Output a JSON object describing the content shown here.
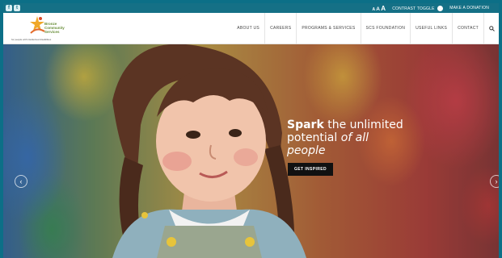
{
  "topbar": {
    "social": [
      {
        "icon": "facebook-icon",
        "glyph": "f"
      },
      {
        "icon": "twitter-icon",
        "glyph": "t"
      }
    ],
    "font_sizes": [
      "A",
      "A",
      "A"
    ],
    "contrast_label": "CONTRAST",
    "toggle_label": "TOGGLE",
    "donate_label": "MAKE A DONATION"
  },
  "logo": {
    "name_line1": "Bronze",
    "name_line2": "Community",
    "name_line3": "Services",
    "tagline": "for people with intellectual disabilities"
  },
  "nav": {
    "items": [
      "ABOUT US",
      "CAREERS",
      "PROGRAMS & SERVICES",
      "SCS FOUNDATION",
      "USEFUL LINKS",
      "CONTACT"
    ],
    "search_icon": "search-icon"
  },
  "hero": {
    "headline_bold": "Spark",
    "headline_rest1": " the unlimited",
    "headline_line2a": "potential ",
    "headline_line2b": "of all",
    "headline_line3": "people",
    "cta_label": "GET INSPIRED",
    "prev_icon": "chevron-left-icon",
    "next_icon": "chevron-right-icon"
  },
  "colors": {
    "topbar": "#157086",
    "page_border": "#0c6f87",
    "cta_bg": "#111111"
  }
}
